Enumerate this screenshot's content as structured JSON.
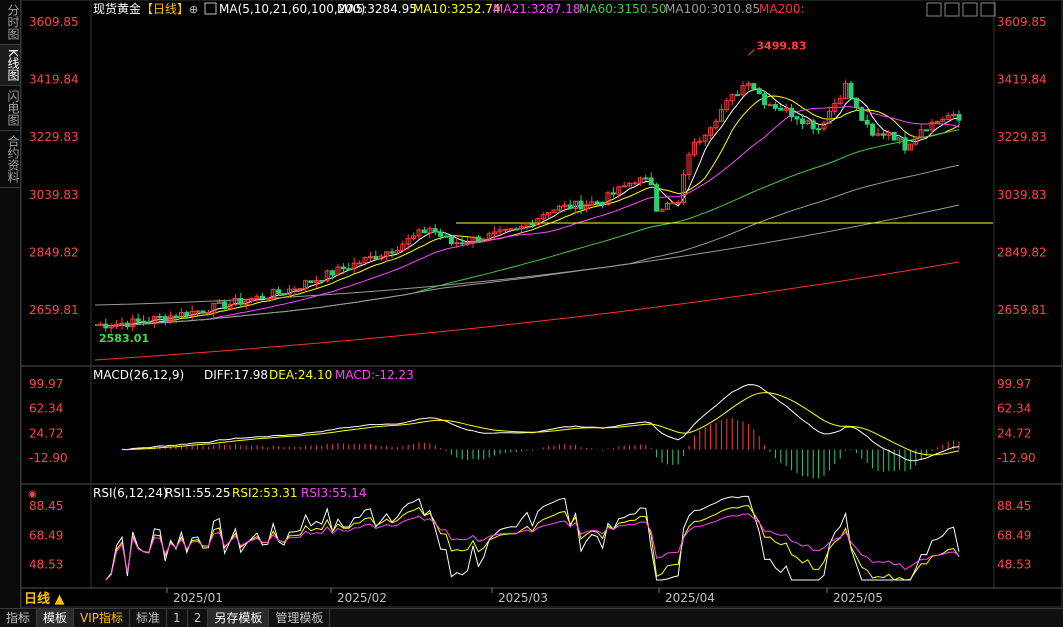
{
  "sidebar": {
    "tabs": [
      {
        "label": "分时图",
        "active": false
      },
      {
        "label": "K线图",
        "active": true
      },
      {
        "label": "闪电图",
        "active": false
      },
      {
        "label": "合约资料",
        "active": false
      }
    ]
  },
  "main": {
    "instrument": "现货黄金",
    "period_bracket": "【日线】",
    "ma_params": "MA(5,10,21,60,100,200)",
    "ma": [
      {
        "label": "MA5:3284.95",
        "color": "#ffffff"
      },
      {
        "label": "MA10:3252.74",
        "color": "#ffff00"
      },
      {
        "label": "MA21:3287.18",
        "color": "#ff44ff"
      },
      {
        "label": "MA60:3150.50",
        "color": "#44cc44"
      },
      {
        "label": "MA100:3010.85",
        "color": "#9a9a9a"
      },
      {
        "label": "MA200:",
        "color": "#ff3030"
      }
    ],
    "y_ticks": [
      "3609.85",
      "3419.84",
      "3229.83",
      "3039.83",
      "2849.82",
      "2659.81"
    ],
    "high_label": "3499.83",
    "low_label": "2583.01",
    "horizontal_line": 2947
  },
  "macd": {
    "title": "MACD(26,12,9)",
    "diff_label": "DIFF:17.98",
    "dea_label": "DEA:24.10",
    "macd_label": "MACD:-12.23",
    "y_ticks": [
      "99.97",
      "62.34",
      "24.72",
      "-12.90"
    ]
  },
  "rsi": {
    "title": "RSI(6,12,24)",
    "rsi1_label": "RSI1:55.25",
    "rsi2_label": "RSI2:53.31",
    "rsi3_label": "RSI3:55.14",
    "y_ticks": [
      "88.45",
      "68.49",
      "48.53"
    ]
  },
  "x_axis": {
    "labels": [
      "2025/01",
      "2025/02",
      "2025/03",
      "2025/04",
      "2025/05"
    ]
  },
  "period_selector": "日线",
  "bottom_tabs": [
    {
      "label": "指标",
      "active": false,
      "vip": false
    },
    {
      "label": "模板",
      "active": true,
      "vip": false
    },
    {
      "label": "VIP指标",
      "active": false,
      "vip": true
    },
    {
      "label": "标准",
      "active": false,
      "vip": false
    },
    {
      "label": "1",
      "active": false,
      "vip": false
    },
    {
      "label": "2",
      "active": false,
      "vip": false
    },
    {
      "label": "另存模板",
      "active": true,
      "vip": false
    },
    {
      "label": "管理模板",
      "active": false,
      "vip": false
    }
  ],
  "chart_data": {
    "type": "candlestick",
    "ylim": [
      2583.01,
      3609.85
    ],
    "key_points": [
      {
        "x": "start",
        "value": 2583.01
      },
      {
        "x": "2025/01",
        "value": 2660
      },
      {
        "x": "2025/02",
        "value": 2860
      },
      {
        "x": "2025/03",
        "value": 2920
      },
      {
        "x": "2025/04",
        "value": 3100
      },
      {
        "x": "2025/04-late",
        "value": 3499.83
      },
      {
        "x": "2025/05",
        "value": 3300
      },
      {
        "x": "end",
        "value": 3285
      }
    ]
  }
}
